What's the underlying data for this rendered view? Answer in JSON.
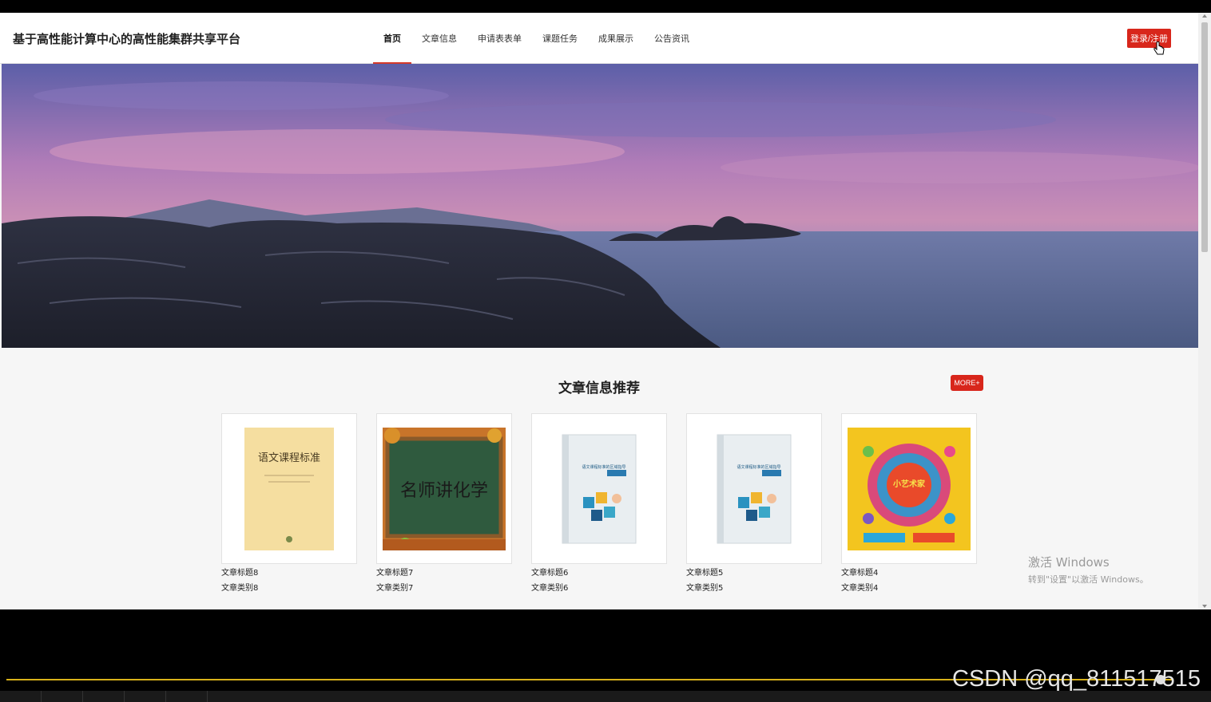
{
  "header": {
    "site_title": "基于高性能计算中心的高性能集群共享平台",
    "nav": [
      "首页",
      "文章信息",
      "申请表表单",
      "课题任务",
      "成果展示",
      "公告资讯"
    ],
    "active_index": 0,
    "login_label": "登录/注册"
  },
  "section": {
    "title": "文章信息推荐",
    "more_label": "MORE+"
  },
  "cards": [
    {
      "title": "文章标题8",
      "category": "文章类别8",
      "cover_text": "语文课程标准"
    },
    {
      "title": "文章标题7",
      "category": "文章类别7",
      "cover_text": "名师讲化学"
    },
    {
      "title": "文章标题6",
      "category": "文章类别6",
      "cover_text": "语文课程标准的区域指导"
    },
    {
      "title": "文章标题5",
      "category": "文章类别5",
      "cover_text": "语文课程标准的区域指导"
    },
    {
      "title": "文章标题4",
      "category": "文章类别4",
      "cover_text": "小艺术家"
    }
  ],
  "watermark": {
    "line1": "激活 Windows",
    "line2": "转到\"设置\"以激活 Windows。"
  },
  "overlay": {
    "csdn": "CSDN @qq_811517515"
  },
  "colors": {
    "accent_red": "#d8261b",
    "nav_underline": "#d43a2a",
    "progress_track": "#d8b21a"
  }
}
